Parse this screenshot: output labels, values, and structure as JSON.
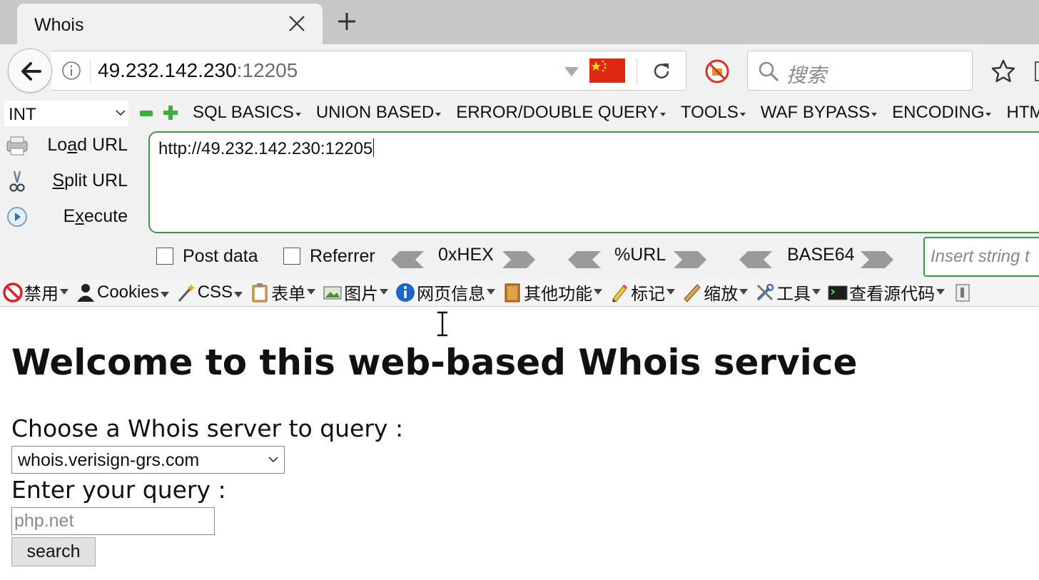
{
  "tab": {
    "title": "Whois"
  },
  "address_bar": {
    "host": "49.232.142.230",
    "port": ":12205"
  },
  "search": {
    "placeholder": "搜索"
  },
  "hackbar": {
    "type_select": "INT",
    "menus": [
      "SQL BASICS",
      "UNION BASED",
      "ERROR/DOUBLE QUERY",
      "TOOLS",
      "WAF BYPASS",
      "ENCODING",
      "HTML"
    ],
    "load_url": {
      "pre": "Lo",
      "key": "a",
      "post": "d URL"
    },
    "split_url": {
      "pre": "",
      "key": "S",
      "post": "plit URL"
    },
    "execute": {
      "pre": "E",
      "key": "x",
      "post": "ecute"
    },
    "url_value": "http://49.232.142.230:12205",
    "post_data_label": "Post data",
    "referrer_label": "Referrer",
    "hex_label": "0xHEX",
    "urlenc_label": "%URL",
    "base64_label": "BASE64",
    "insert_placeholder": "Insert string t"
  },
  "webdev": {
    "items": [
      "禁用",
      "Cookies",
      "CSS",
      "表单",
      "图片",
      "网页信息",
      "其他功能",
      "标记",
      "缩放",
      "工具",
      "查看源代码"
    ]
  },
  "page": {
    "heading": "Welcome to this web-based Whois service",
    "server_label": "Choose a Whois server to query :",
    "server_value": "whois.verisign-grs.com",
    "query_label": "Enter your query :",
    "query_placeholder": "php.net",
    "search_button": "search"
  }
}
